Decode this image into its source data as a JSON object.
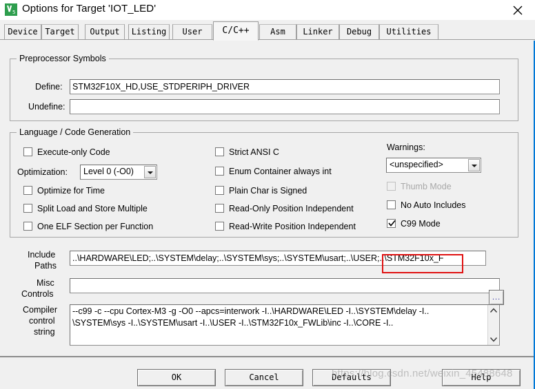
{
  "window": {
    "title": "Options for Target 'IOT_LED'",
    "app_icon": "keil-uvision-logo-icon",
    "close_label": "✕"
  },
  "tabs": [
    {
      "label": "Device",
      "selected": false
    },
    {
      "label": "Target",
      "selected": false
    },
    {
      "label": "Output",
      "selected": false
    },
    {
      "label": "Listing",
      "selected": false
    },
    {
      "label": "User",
      "selected": false
    },
    {
      "label": "C/C++",
      "selected": true
    },
    {
      "label": "Asm",
      "selected": false
    },
    {
      "label": "Linker",
      "selected": false
    },
    {
      "label": "Debug",
      "selected": false
    },
    {
      "label": "Utilities",
      "selected": false
    }
  ],
  "preprocessor": {
    "group_label": "Preprocessor Symbols",
    "define_label": "Define:",
    "define_value": "STM32F10X_HD,USE_STDPERIPH_DRIVER",
    "undefine_label": "Undefine:",
    "undefine_value": ""
  },
  "language": {
    "group_label": "Language / Code Generation",
    "left_column": [
      {
        "label": "Execute-only Code",
        "checked": false,
        "disabled": false
      },
      {
        "label": "Optimize for Time",
        "checked": false,
        "disabled": false
      },
      {
        "label": "Split Load and Store Multiple",
        "checked": false,
        "disabled": false
      },
      {
        "label": "One ELF Section per Function",
        "checked": false,
        "disabled": false
      }
    ],
    "optimization_label": "Optimization:",
    "optimization_value": "Level 0 (-O0)",
    "middle_column": [
      {
        "label": "Strict ANSI C",
        "checked": false,
        "disabled": false
      },
      {
        "label": "Enum Container always int",
        "checked": false,
        "disabled": false
      },
      {
        "label": "Plain Char is Signed",
        "checked": false,
        "disabled": false
      },
      {
        "label": "Read-Only Position Independent",
        "checked": false,
        "disabled": false
      },
      {
        "label": "Read-Write Position Independent",
        "checked": false,
        "disabled": false
      }
    ],
    "warnings_label": "Warnings:",
    "warnings_value": "<unspecified>",
    "right_column": [
      {
        "label": "Thumb Mode",
        "checked": false,
        "disabled": true
      },
      {
        "label": "No Auto Includes",
        "checked": false,
        "disabled": false
      },
      {
        "label": "C99 Mode",
        "checked": true,
        "disabled": false,
        "highlighted": true
      }
    ]
  },
  "paths": {
    "include_label_line1": "Include",
    "include_label_line2": "Paths",
    "include_value": "..\\HARDWARE\\LED;..\\SYSTEM\\delay;..\\SYSTEM\\sys;..\\SYSTEM\\usart;..\\USER;..\\STM32F10x_F",
    "browse_label": "...",
    "misc_label_line1": "Misc",
    "misc_label_line2": "Controls",
    "misc_value": "",
    "compiler_label_line1": "Compiler",
    "compiler_label_line2": "control",
    "compiler_label_line3": "string",
    "compiler_value_line1": "--c99 -c --cpu Cortex-M3 -g -O0 --apcs=interwork -I..\\HARDWARE\\LED -I..\\SYSTEM\\delay -I..",
    "compiler_value_line2": "\\SYSTEM\\sys -I..\\SYSTEM\\usart -I..\\USER -I..\\STM32F10x_FWLib\\inc -I..\\CORE -I.."
  },
  "footer": {
    "ok": "OK",
    "cancel": "Cancel",
    "defaults": "Defaults",
    "help": "Help"
  },
  "watermark": "https://blog.csdn.net/weixin_45488648",
  "colors": {
    "accent_border": "#0078d7",
    "highlight_red": "#e01010",
    "dialog_bg": "#f0f0f0",
    "field_bg": "#ffffff"
  }
}
